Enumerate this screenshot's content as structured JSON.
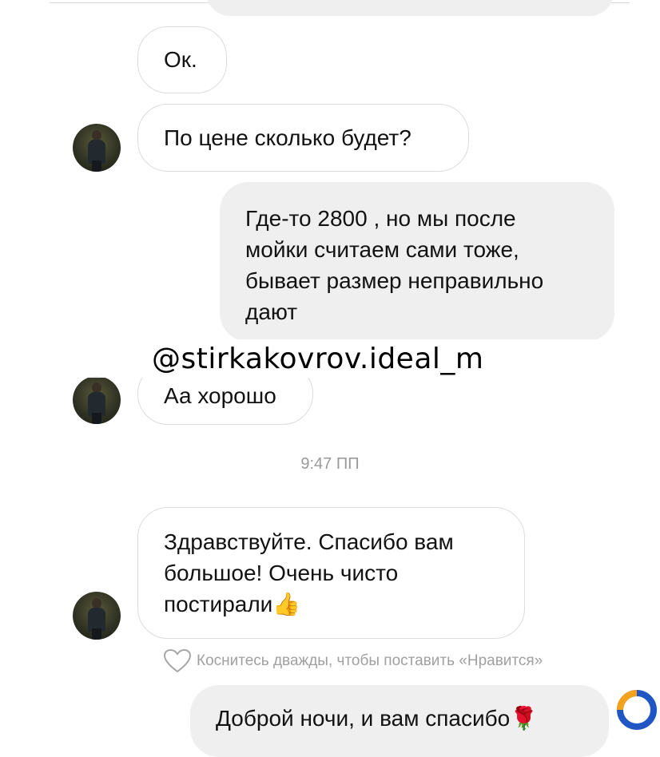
{
  "messages": {
    "ok": "Ок.",
    "price_question": "По цене сколько будет?",
    "answer": {
      "line1": "Где-то 2800 , но мы после",
      "line2": "мойки считаем сами тоже,",
      "line3": "бывает размер неправильно",
      "line4": "дают"
    },
    "good": "Аа хорошо",
    "thanks": {
      "line1": "Здравствуйте. Спасибо вам",
      "line2": "большое! Очень чисто",
      "line3": "постирали",
      "emoji": "👍"
    },
    "good_night": "Доброй ночи, и вам спасибо",
    "good_night_emoji": "🌹"
  },
  "watermark": "@stirkakovrov.ideal_m",
  "timestamp": "9:47 ПП",
  "like_hint": "Коснитесь дважды, чтобы поставить «Нравится»",
  "icons": {
    "heart": "heart-outline-icon",
    "thumbs_up": "thumbs-up-emoji",
    "rose": "rose-emoji",
    "logo": "brand-logo-icon"
  },
  "colors": {
    "incoming_bubble_border": "#dcdcdc",
    "outgoing_bubble_bg": "#efefef",
    "timestamp": "#9a9a9a",
    "logo_blue": "#1f56c4",
    "logo_orange": "#f4a21c"
  }
}
